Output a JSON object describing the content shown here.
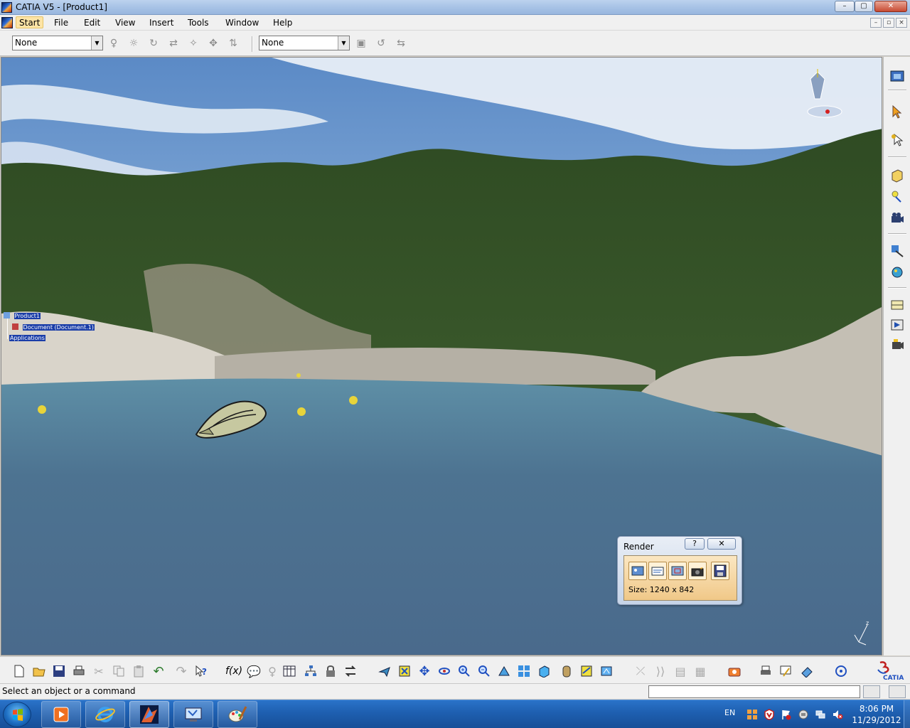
{
  "window": {
    "title": "CATIA V5 - [Product1]",
    "minimize_label": "–",
    "restore_label": "▢",
    "close_label": "✕"
  },
  "menu": {
    "items": [
      "Start",
      "File",
      "Edit",
      "View",
      "Insert",
      "Tools",
      "Window",
      "Help"
    ],
    "active": "Start"
  },
  "toolbar_top": {
    "combo1_value": "None",
    "combo2_value": "None"
  },
  "spec_tree": {
    "root": "Product1",
    "child": "Document (Document.1)",
    "applications": "Applications"
  },
  "render_panel": {
    "title": "Render",
    "help_label": "?",
    "close_label": "✕",
    "size_text": "Size: 1240 x 842"
  },
  "status": {
    "message": "Select an object or a command"
  },
  "taskbar": {
    "language": "EN",
    "time": "8:06 PM",
    "date": "11/29/2012"
  },
  "colors": {
    "sky_top": "#5f8fc8",
    "water": "#4c6f92",
    "foliage": "#2e4a22",
    "rock": "#c9c4ba",
    "taskbar": "#1e5fb0"
  }
}
